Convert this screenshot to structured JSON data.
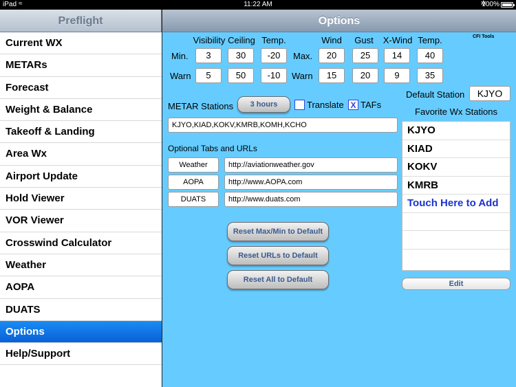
{
  "status_bar": {
    "carrier": "iPad",
    "time": "11:22 AM",
    "battery": "100%",
    "wifi_icon": "wifi-icon",
    "bluetooth_icon": "bluetooth-icon",
    "battery_icon": "battery-icon"
  },
  "master": {
    "title": "Preflight",
    "items": [
      {
        "label": "Current WX"
      },
      {
        "label": "METARs"
      },
      {
        "label": "Forecast"
      },
      {
        "label": "Weight & Balance"
      },
      {
        "label": "Takeoff & Landing"
      },
      {
        "label": "Area Wx"
      },
      {
        "label": "Airport Update"
      },
      {
        "label": "Hold Viewer"
      },
      {
        "label": "VOR Viewer"
      },
      {
        "label": "Crosswind Calculator"
      },
      {
        "label": "Weather"
      },
      {
        "label": "AOPA"
      },
      {
        "label": "DUATS"
      },
      {
        "label": "Options",
        "selected": true
      },
      {
        "label": "Help/Support"
      }
    ]
  },
  "detail": {
    "title": "Options",
    "brand": "CFI Tools",
    "limits": {
      "headers": {
        "visibility": "Visibility",
        "ceiling": "Ceiling",
        "temp": "Temp.",
        "wind": "Wind",
        "gust": "Gust",
        "xwind": "X-Wind",
        "temp2": "Temp."
      },
      "min_label": "Min.",
      "max_label": "Max.",
      "warn_label": "Warn",
      "warn_label2": "Warn",
      "min": {
        "visibility": "3",
        "ceiling": "30",
        "temp": "-20"
      },
      "warn_left": {
        "visibility": "5",
        "ceiling": "50",
        "temp": "-10"
      },
      "max": {
        "wind": "20",
        "gust": "25",
        "xwind": "14",
        "temp": "40"
      },
      "warn_right": {
        "wind": "15",
        "gust": "20",
        "xwind": "9",
        "temp": "35"
      }
    },
    "metar": {
      "label": "METAR Stations",
      "hours_button": "3 hours",
      "translate_label": "Translate",
      "translate_checked": false,
      "tafs_label": "TAFs",
      "tafs_checked": true,
      "tafs_mark": "X",
      "stations_value": "KJYO,KIAD,KOKV,KMRB,KOMH,KCHO"
    },
    "optional_tabs": {
      "label": "Optional Tabs and URLs",
      "rows": [
        {
          "name": "Weather",
          "url": "http://aviationweather.gov"
        },
        {
          "name": "AOPA",
          "url": "http://www.AOPA.com"
        },
        {
          "name": "DUATS",
          "url": "http://www.duats.com"
        }
      ]
    },
    "buttons": {
      "reset_maxmin": "Reset Max/Min to Default",
      "reset_urls": "Reset URLs to Default",
      "reset_all": "Reset All to Default"
    },
    "default_station": {
      "label": "Default Station",
      "value": "KJYO"
    },
    "favorites": {
      "label": "Favorite Wx Stations",
      "items": [
        "KJYO",
        "KIAD",
        "KOKV",
        "KMRB"
      ],
      "add_label": "Touch Here to Add",
      "edit_button": "Edit"
    }
  },
  "colors": {
    "detail_background": "#66ccff",
    "selection": "#0a6ee6",
    "add_link": "#1a33cc"
  }
}
